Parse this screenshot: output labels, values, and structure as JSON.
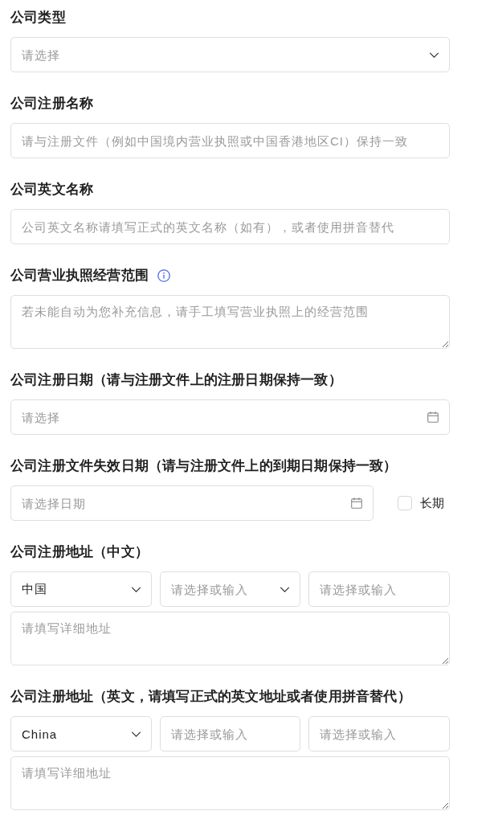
{
  "fields": [
    {
      "label": "公司类型",
      "kind": "select",
      "placeholder": "请选择"
    },
    {
      "label": "公司注册名称",
      "kind": "text",
      "placeholder": "请与注册文件（例如中国境内营业执照或中国香港地区CI）保持一致"
    },
    {
      "label": "公司英文名称",
      "kind": "text",
      "placeholder": "公司英文名称请填写正式的英文名称（如有），或者使用拼音替代"
    },
    {
      "label": "公司营业执照经营范围",
      "info": true,
      "kind": "textarea",
      "placeholder": "若未能自动为您补充信息，请手工填写营业执照上的经营范围"
    },
    {
      "label": "公司注册日期（请与注册文件上的注册日期保持一致）",
      "kind": "date",
      "placeholder": "请选择"
    },
    {
      "label": "公司注册文件失效日期（请与注册文件上的到期日期保持一致）",
      "kind": "date",
      "placeholder": "请选择日期",
      "checkbox": {
        "label": "长期",
        "checked": false
      }
    },
    {
      "label": "公司注册地址（中文）",
      "kind": "address",
      "parts": [
        {
          "kind": "select",
          "value": "中国"
        },
        {
          "kind": "select",
          "placeholder": "请选择或输入"
        },
        {
          "kind": "text",
          "placeholder": "请选择或输入"
        }
      ],
      "detail": {
        "placeholder": "请填写详细地址"
      }
    },
    {
      "label": "公司注册地址（英文，请填写正式的英文地址或者使用拼音替代）",
      "kind": "address",
      "parts": [
        {
          "kind": "select",
          "value": "China"
        },
        {
          "kind": "text",
          "placeholder": "请选择或输入"
        },
        {
          "kind": "text",
          "placeholder": "请选择或输入"
        }
      ],
      "detail": {
        "placeholder": "请填写详细地址"
      }
    }
  ]
}
